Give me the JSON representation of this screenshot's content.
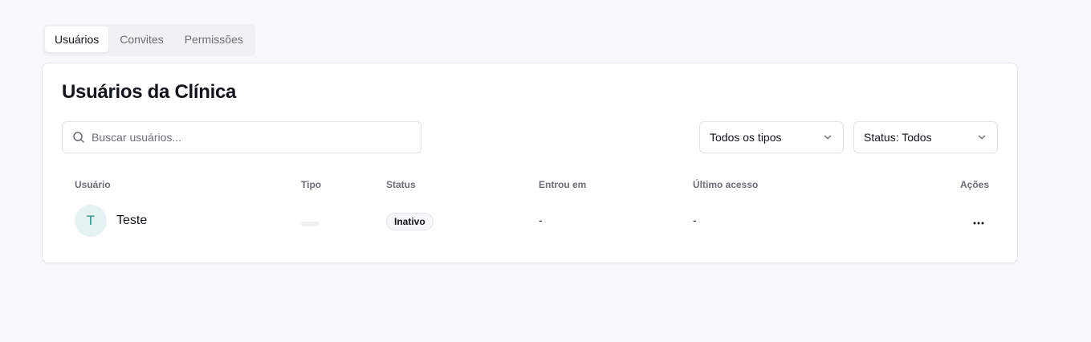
{
  "tabs": [
    {
      "label": "Usuários",
      "active": true
    },
    {
      "label": "Convites",
      "active": false
    },
    {
      "label": "Permissões",
      "active": false
    }
  ],
  "card": {
    "title": "Usuários da Clínica"
  },
  "search": {
    "placeholder": "Buscar usuários...",
    "value": "",
    "icon": "search-icon"
  },
  "filters": {
    "type": {
      "selected": "Todos os tipos",
      "icon": "chevron-down-icon"
    },
    "status": {
      "selected": "Status: Todos",
      "icon": "chevron-down-icon"
    }
  },
  "table": {
    "columns": [
      "Usuário",
      "Tipo",
      "Status",
      "Entrou em",
      "Último acesso",
      "Ações"
    ],
    "rows": [
      {
        "avatar_initial": "T",
        "name": "Teste",
        "type": "",
        "status": "Inativo",
        "joined": "-",
        "last_access": "-",
        "actions_icon": "more-horizontal-icon"
      }
    ]
  },
  "colors": {
    "background": "#f8f9fa",
    "card": "#ffffff",
    "border": "#e3e5e8",
    "muted_text": "#6b6f75",
    "avatar_bg": "#e6f2f1",
    "avatar_fg": "#2f8f86"
  }
}
